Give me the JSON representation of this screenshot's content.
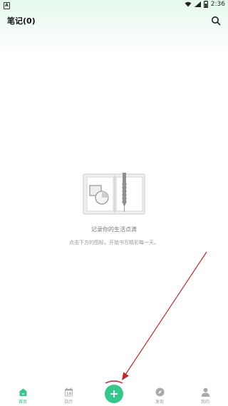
{
  "status_bar": {
    "left_indicator": "A",
    "time": "2:36"
  },
  "header": {
    "title": "笔记(0)"
  },
  "empty_state": {
    "title": "记录你的生活点滴",
    "subtitle": "点击下方的图标，开始书写精彩每一天。"
  },
  "tabbar": {
    "tabs": [
      {
        "label": "首页",
        "icon": "home-icon",
        "active": true
      },
      {
        "label": "日历",
        "icon": "calendar-icon",
        "active": false
      },
      {
        "label": "发现",
        "icon": "compass-icon",
        "active": false
      },
      {
        "label": "我的",
        "icon": "user-icon",
        "active": false
      }
    ],
    "calendar_day": "18",
    "add_button_icon": "plus-icon"
  },
  "colors": {
    "accent": "#34c98a",
    "annotation": "#c0282b"
  }
}
